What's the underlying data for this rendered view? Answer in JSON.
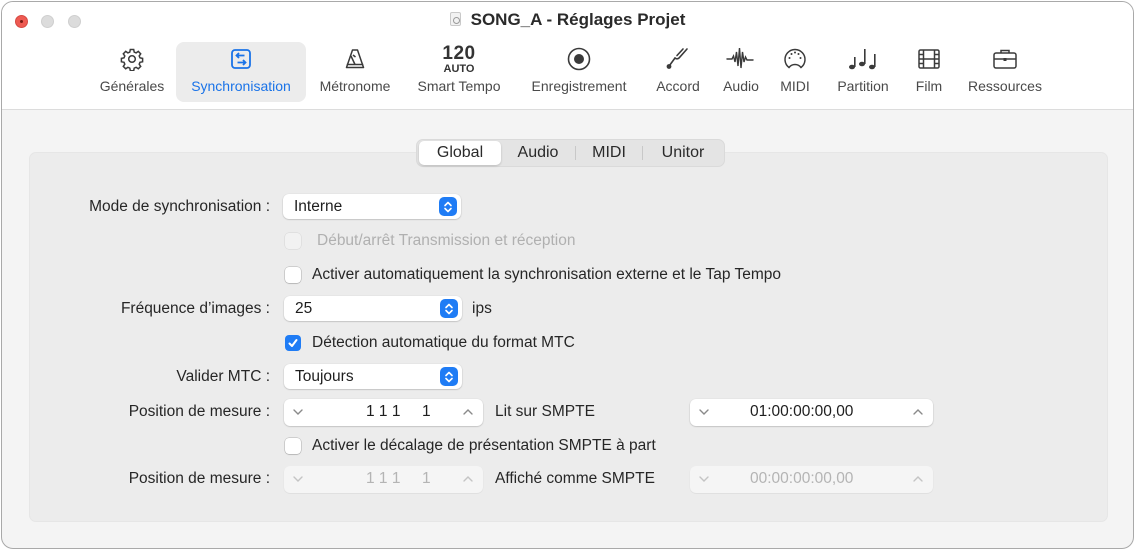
{
  "window": {
    "title": "SONG_A - Réglages Projet",
    "buttons": [
      "close",
      "minimize",
      "zoom"
    ]
  },
  "toolbar": {
    "items": [
      {
        "label": "Générales",
        "icon": "gear-icon",
        "active": false
      },
      {
        "label": "Synchronisation",
        "icon": "sync-icon",
        "active": true
      },
      {
        "label": "Métronome",
        "icon": "metronome-icon",
        "active": false
      },
      {
        "label": "Smart Tempo",
        "icon": "tempo-readout",
        "tempo_value": "120",
        "tempo_mode": "AUTO",
        "active": false
      },
      {
        "label": "Enregistrement",
        "icon": "record-icon",
        "active": false
      },
      {
        "label": "Accord",
        "icon": "tuning-fork-icon",
        "active": false
      },
      {
        "label": "Audio",
        "icon": "waveform-icon",
        "active": false
      },
      {
        "label": "MIDI",
        "icon": "midi-port-icon",
        "active": false
      },
      {
        "label": "Partition",
        "icon": "music-notes-icon",
        "active": false
      },
      {
        "label": "Film",
        "icon": "film-icon",
        "active": false
      },
      {
        "label": "Ressources",
        "icon": "briefcase-icon",
        "active": false
      }
    ]
  },
  "tabs": {
    "items": [
      "Global",
      "Audio",
      "MIDI",
      "Unitor"
    ],
    "selected": "Global"
  },
  "form": {
    "sync_mode": {
      "label": "Mode de synchronisation :",
      "value": "Interne"
    },
    "transmit_start_stop": {
      "label": "Début/arrêt Transmission et réception",
      "checked": false,
      "enabled": false
    },
    "auto_external_sync": {
      "label": "Activer automatiquement la synchronisation externe et le Tap Tempo",
      "checked": false,
      "enabled": true
    },
    "frame_rate": {
      "label": "Fréquence d’images :",
      "value": "25",
      "unit": "ips"
    },
    "auto_mtc_detect": {
      "label": "Détection automatique du format MTC",
      "checked": true,
      "enabled": true
    },
    "validate_mtc": {
      "label": "Valider MTC :",
      "value": "Toujours"
    },
    "bar_position_1": {
      "label": "Position de mesure :",
      "bar_value": "1 1 1     1",
      "smpte_label": "Lit sur SMPTE",
      "smpte_value": "01:00:00:00,00",
      "enabled": true
    },
    "separate_smpte_offset": {
      "label": "Activer le décalage de présentation SMPTE à part",
      "checked": false,
      "enabled": true
    },
    "bar_position_2": {
      "label": "Position de mesure :",
      "bar_value": "1 1 1     1",
      "smpte_label": "Affiché comme SMPTE",
      "smpte_value": "00:00:00:00,00",
      "enabled": false
    }
  },
  "colors": {
    "accent": "#1f7cf5",
    "active_tab_label": "#1a73e8",
    "close_button": "#ee5a52"
  }
}
